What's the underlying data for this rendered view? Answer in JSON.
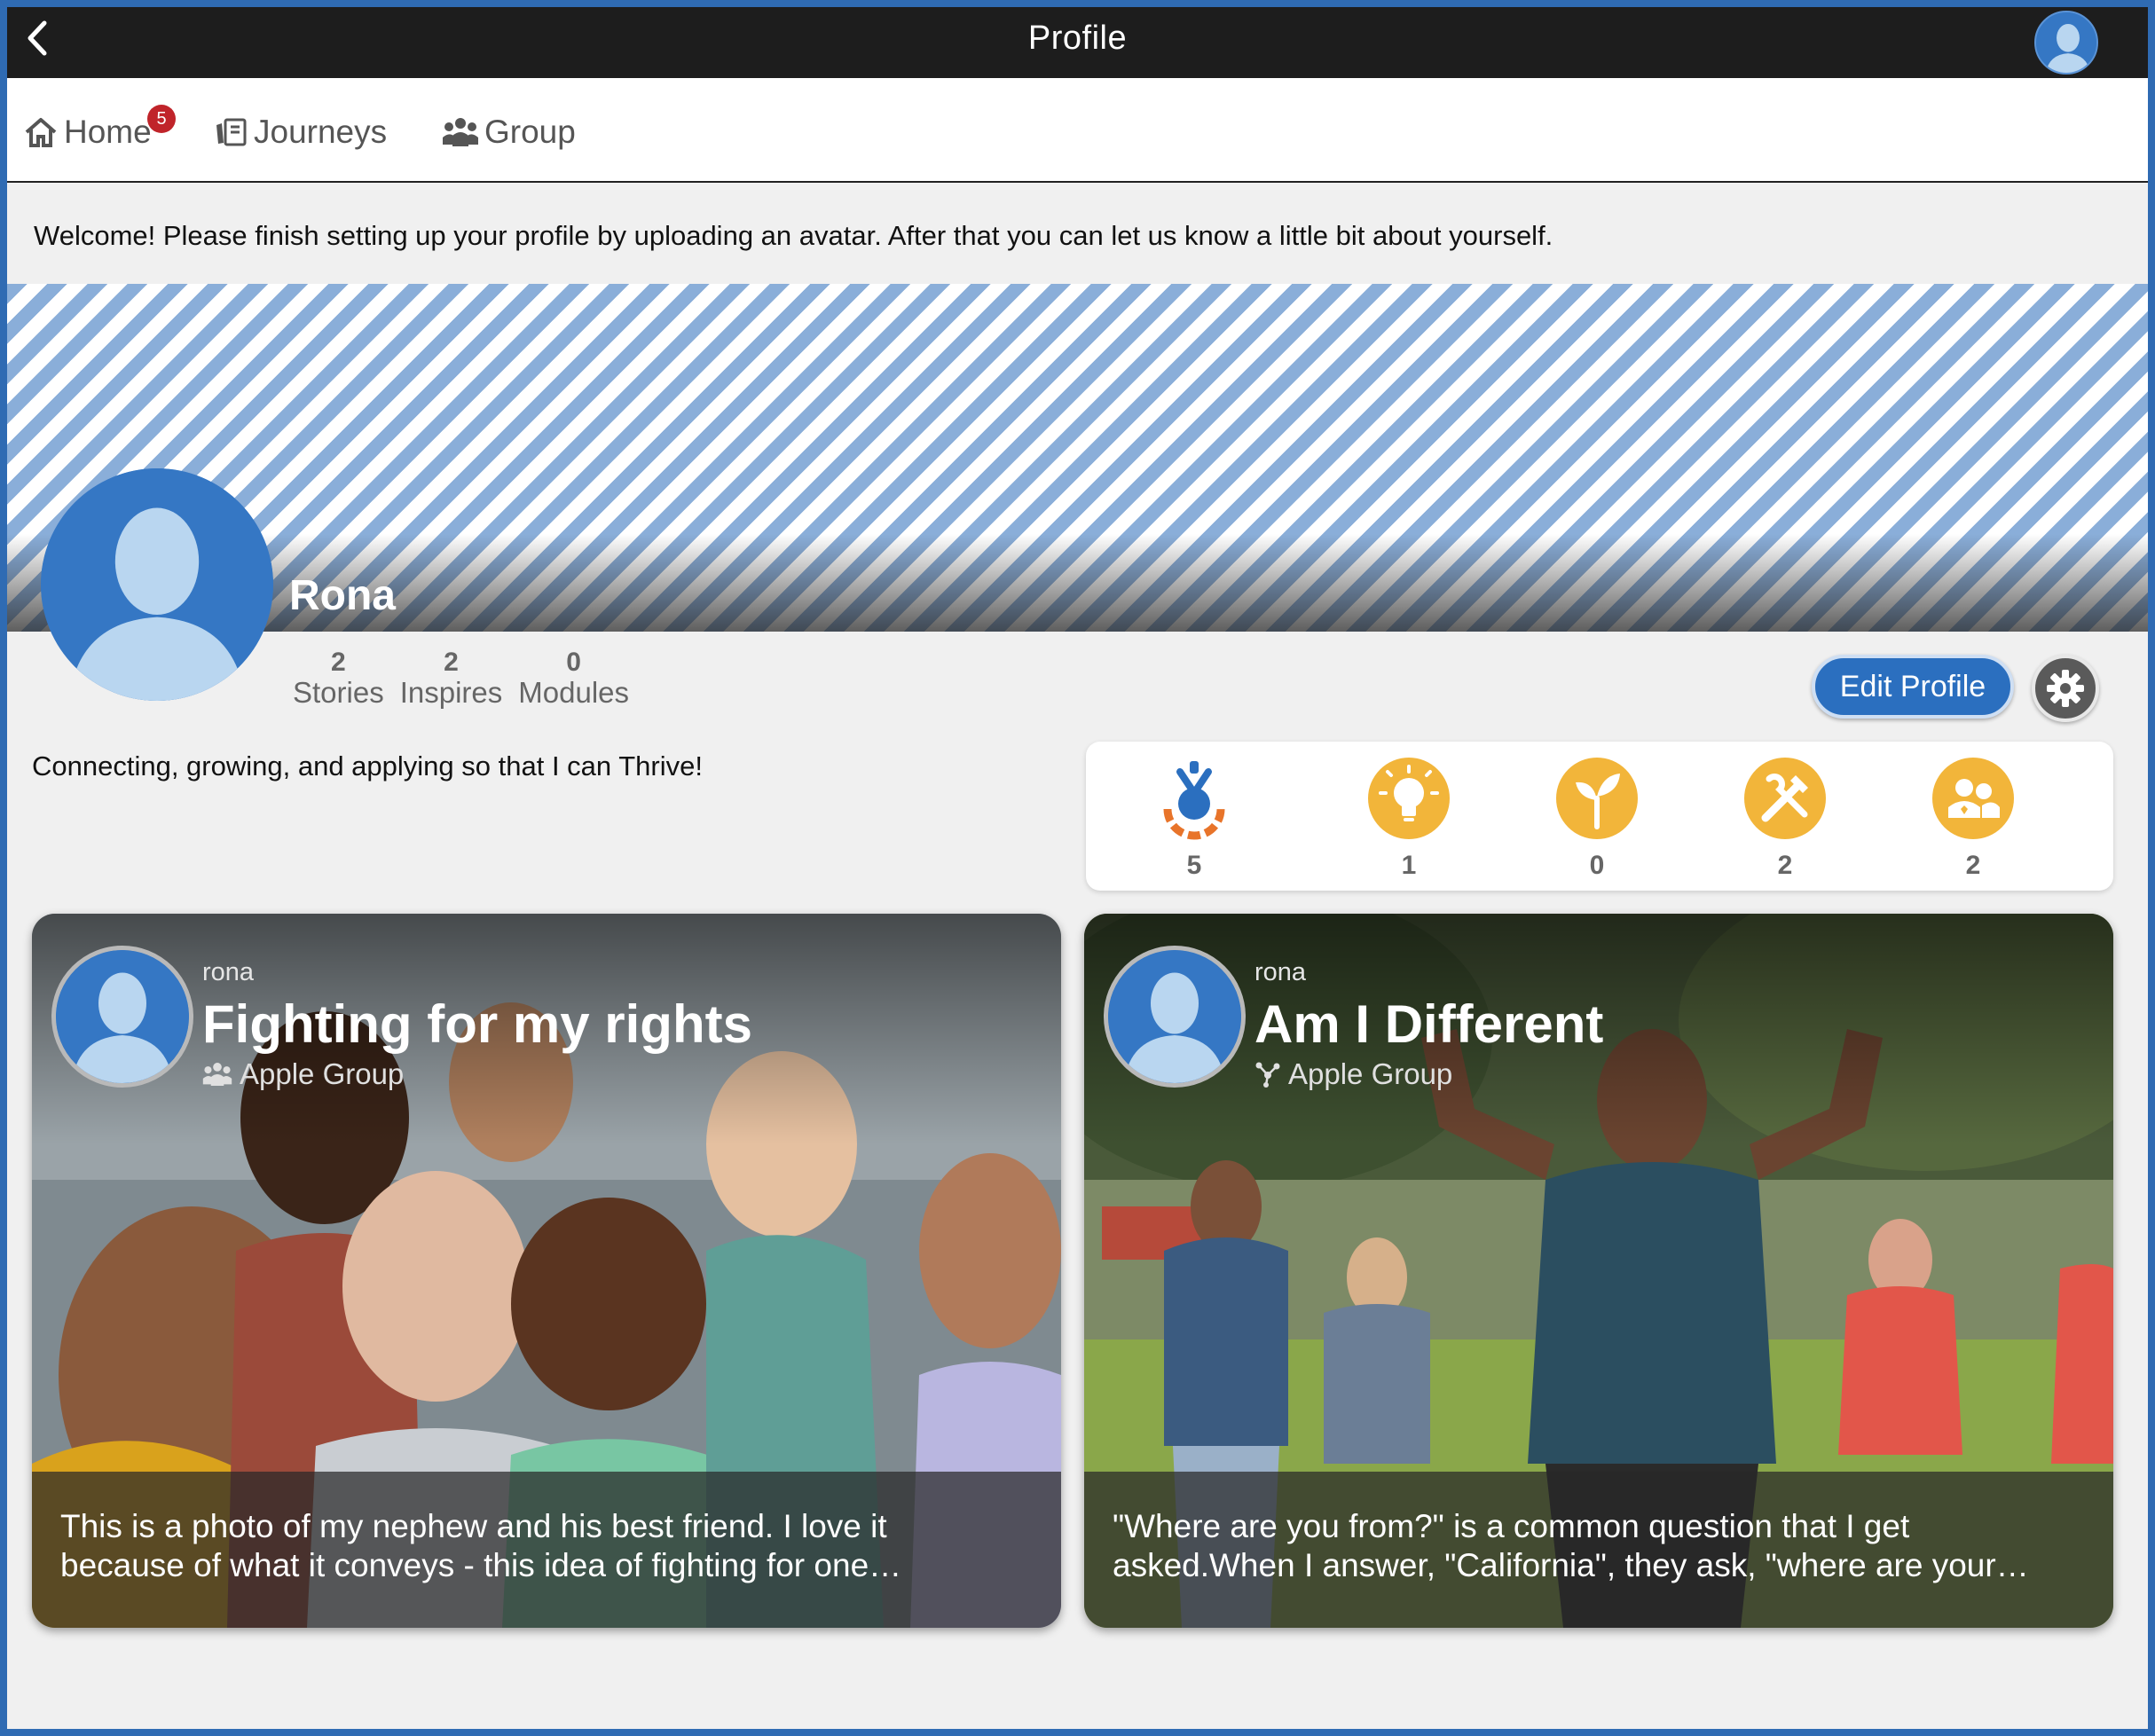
{
  "titlebar": {
    "title": "Profile",
    "back_icon": "chevron-left-icon"
  },
  "nav": {
    "home": {
      "label": "Home",
      "badge": "5"
    },
    "journeys": {
      "label": "Journeys"
    },
    "group": {
      "label": "Group"
    }
  },
  "welcome_text": "Welcome! Please finish setting up your profile by uploading an avatar. After that you can let us know a little bit about yourself.",
  "profile": {
    "name": "Rona",
    "stats": [
      {
        "value": "2",
        "label": "Stories"
      },
      {
        "value": "2",
        "label": "Inspires"
      },
      {
        "value": "0",
        "label": "Modules"
      }
    ],
    "bio": "Connecting, growing, and applying so that I can Thrive!",
    "edit_label": "Edit Profile"
  },
  "badges": [
    {
      "icon": "journey-badge-icon",
      "count": "5"
    },
    {
      "icon": "lightbulb-icon",
      "count": "1"
    },
    {
      "icon": "sprout-icon",
      "count": "0"
    },
    {
      "icon": "tools-icon",
      "count": "2"
    },
    {
      "icon": "people-icon",
      "count": "2"
    }
  ],
  "stories": [
    {
      "author": "rona",
      "title": "Fighting for my rights",
      "group": "Apple Group",
      "excerpt_line1": "This is a photo of my nephew and his best friend. I love it",
      "excerpt_line2": "because of what it conveys - this idea of fighting for one…"
    },
    {
      "author": "rona",
      "title": "Am I Different",
      "group": "Apple Group",
      "excerpt_line1": "\"Where are you from?\" is a common question that I get",
      "excerpt_line2": "asked.When I answer, \"California\", they ask, \"where are your…"
    }
  ],
  "colors": {
    "primary": "#2b6fbf",
    "badge_gold": "#f2b53a",
    "notification": "#c0242a",
    "titlebar": "#1d1d1d"
  }
}
